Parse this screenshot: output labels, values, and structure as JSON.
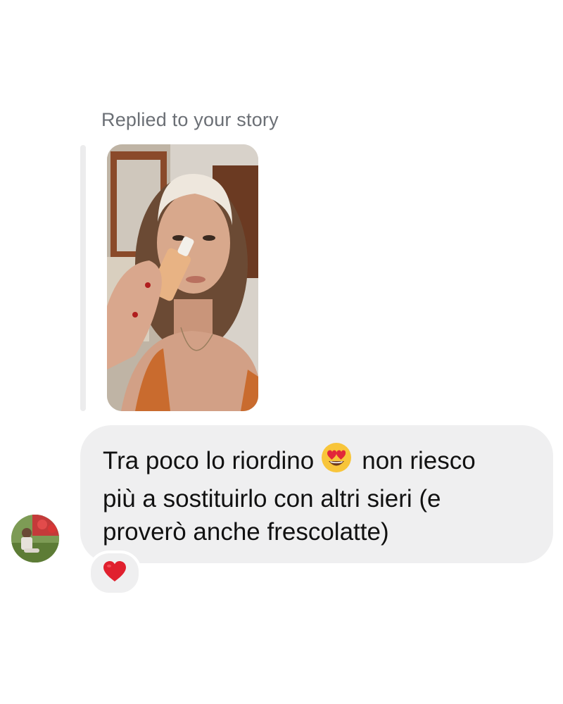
{
  "reply": {
    "label": "Replied to your story"
  },
  "message": {
    "line1_part1": "Tra poco lo riordino",
    "emoji": "heart-eyes-emoji",
    "line1_part2": "non riesco",
    "line2": "più a sostituirlo con altri sieri (e",
    "line3": "proverò anche frescolatte)"
  },
  "reaction": {
    "emoji": "red-heart-emoji"
  },
  "colors": {
    "background": "#ffffff",
    "bubble": "#efeff0",
    "label": "#6b6f75",
    "text": "#111111"
  }
}
